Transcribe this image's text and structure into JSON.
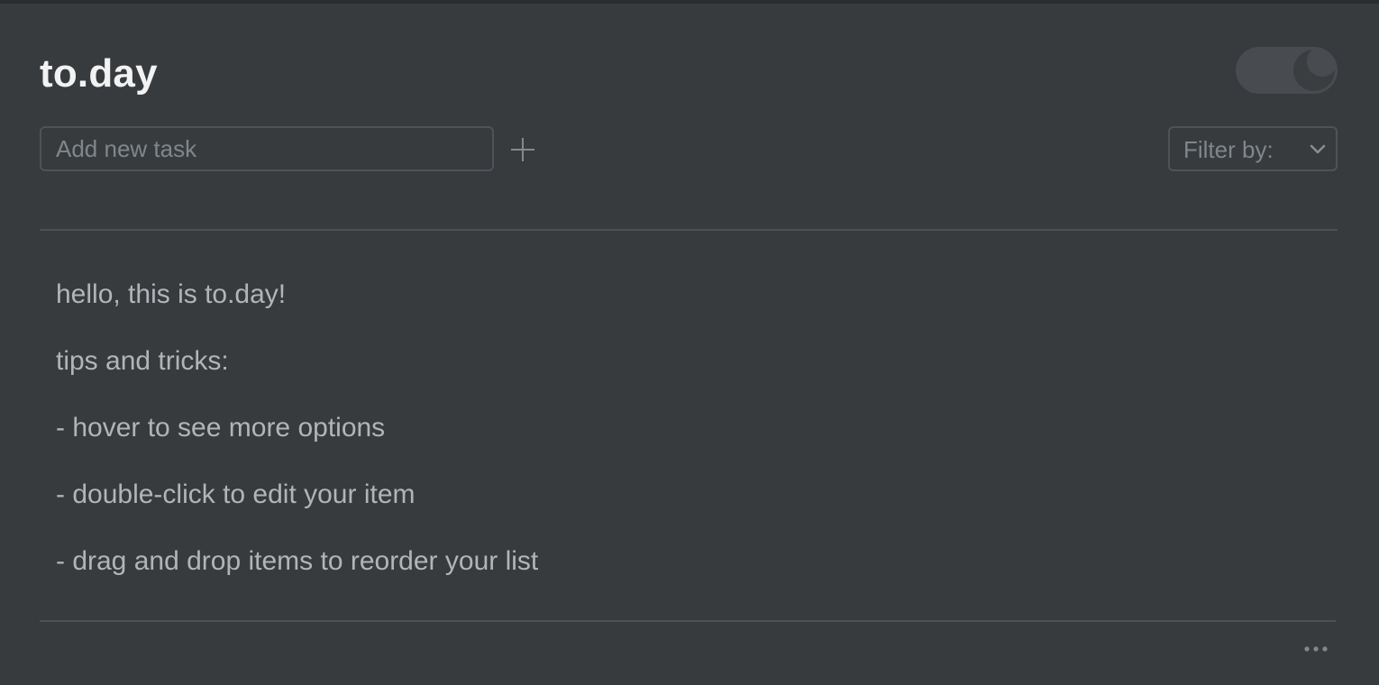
{
  "header": {
    "title": "to.day"
  },
  "theme_toggle": {
    "icon": "moon-icon",
    "state": "dark"
  },
  "task_input": {
    "placeholder": "Add new task",
    "value": ""
  },
  "add_button": {
    "icon": "plus-icon"
  },
  "filter": {
    "label": "Filter by:",
    "icon": "chevron-down-icon"
  },
  "tasks": [
    {
      "text": "hello, this is to.day!"
    },
    {
      "text": "tips and tricks:"
    },
    {
      "text": "- hover to see more options"
    },
    {
      "text": "- double-click to edit your item"
    },
    {
      "text": "- drag and drop items to reorder your list"
    }
  ],
  "footer": {
    "more_icon": "more-options-icon"
  },
  "colors": {
    "background": "#373b3e",
    "title": "#f2f2f2",
    "task_text": "#b2b5b8",
    "muted": "#81868a",
    "border": "#4e5357"
  }
}
